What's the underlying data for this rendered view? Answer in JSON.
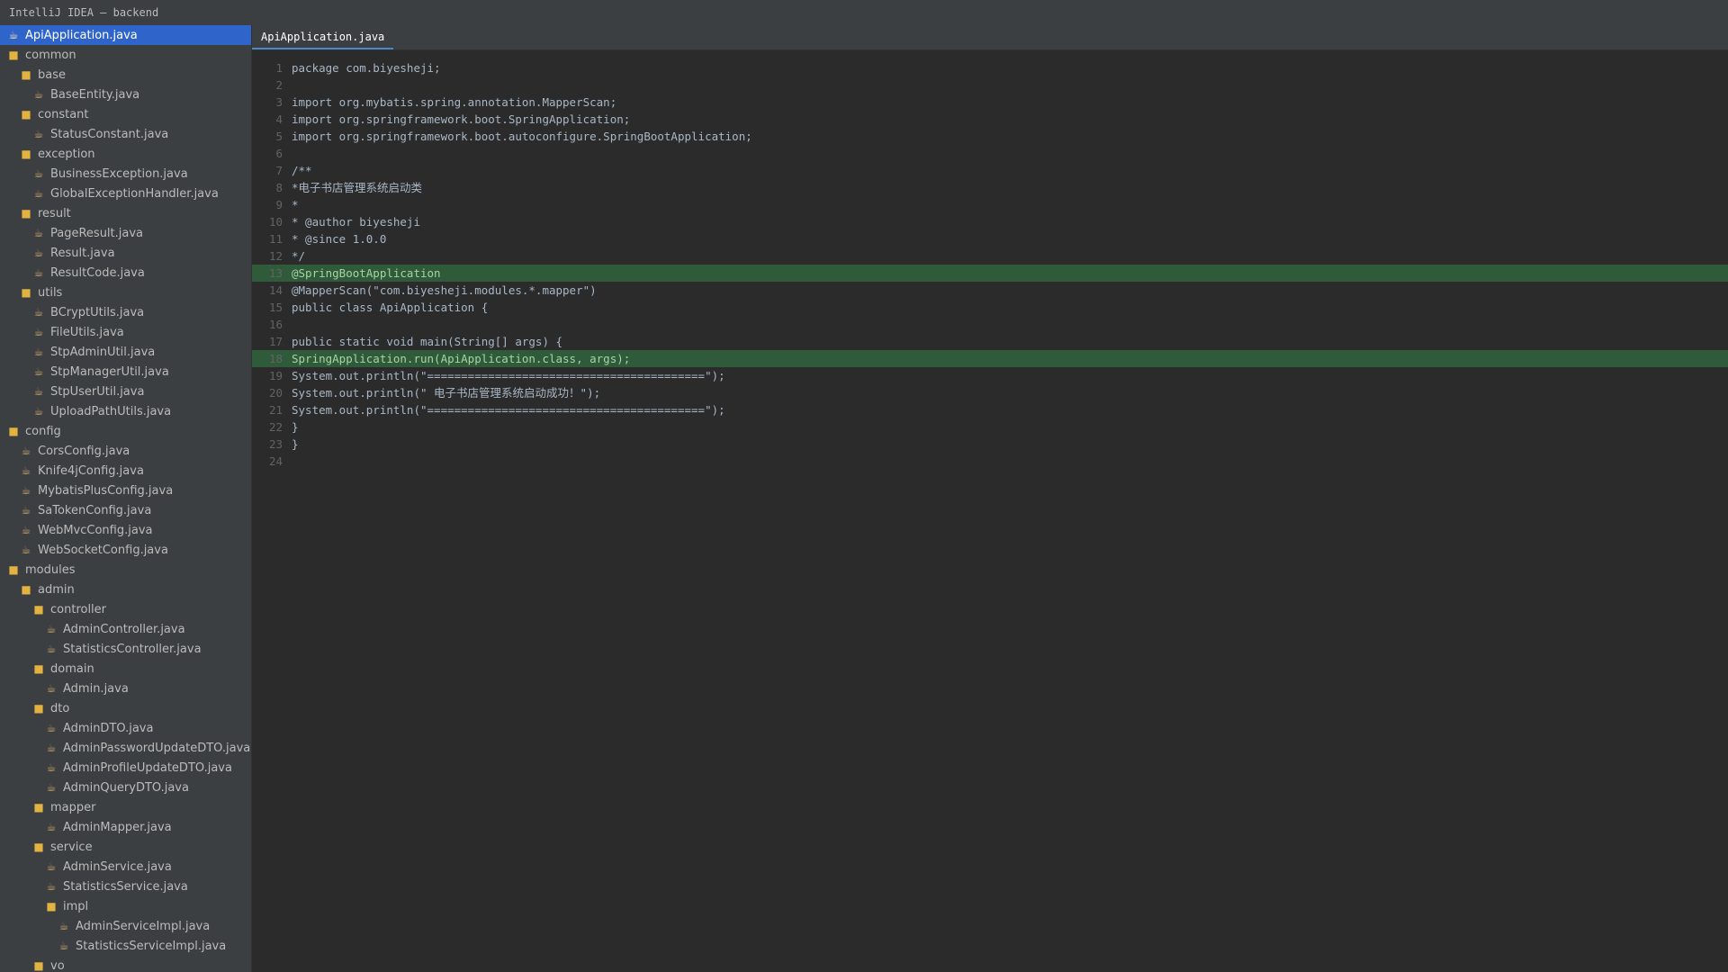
{
  "window": {
    "title": "IntelliJ IDEA — backend"
  },
  "editor": {
    "tab_label": "ApiApplication.java"
  },
  "icons": {
    "folder": "folder-icon",
    "file": "java-file-icon"
  },
  "colors": {
    "selection": "#2f65ca",
    "highlight": "#2f5b3a",
    "accent": "#4a88c7"
  },
  "tree": [
    {
      "label": "ApiApplication.java",
      "type": "file",
      "depth": 0,
      "selected": true
    },
    {
      "label": "common",
      "type": "folder",
      "depth": 0
    },
    {
      "label": "base",
      "type": "folder",
      "depth": 1
    },
    {
      "label": "BaseEntity.java",
      "type": "file",
      "depth": 2
    },
    {
      "label": "constant",
      "type": "folder",
      "depth": 1
    },
    {
      "label": "StatusConstant.java",
      "type": "file",
      "depth": 2
    },
    {
      "label": "exception",
      "type": "folder",
      "depth": 1
    },
    {
      "label": "BusinessException.java",
      "type": "file",
      "depth": 2
    },
    {
      "label": "GlobalExceptionHandler.java",
      "type": "file",
      "depth": 2
    },
    {
      "label": "result",
      "type": "folder",
      "depth": 1
    },
    {
      "label": "PageResult.java",
      "type": "file",
      "depth": 2
    },
    {
      "label": "Result.java",
      "type": "file",
      "depth": 2
    },
    {
      "label": "ResultCode.java",
      "type": "file",
      "depth": 2
    },
    {
      "label": "utils",
      "type": "folder",
      "depth": 1
    },
    {
      "label": "BCryptUtils.java",
      "type": "file",
      "depth": 2
    },
    {
      "label": "FileUtils.java",
      "type": "file",
      "depth": 2
    },
    {
      "label": "StpAdminUtil.java",
      "type": "file",
      "depth": 2
    },
    {
      "label": "StpManagerUtil.java",
      "type": "file",
      "depth": 2
    },
    {
      "label": "StpUserUtil.java",
      "type": "file",
      "depth": 2
    },
    {
      "label": "UploadPathUtils.java",
      "type": "file",
      "depth": 2
    },
    {
      "label": "config",
      "type": "folder",
      "depth": 0
    },
    {
      "label": "CorsConfig.java",
      "type": "file",
      "depth": 1
    },
    {
      "label": "Knife4jConfig.java",
      "type": "file",
      "depth": 1
    },
    {
      "label": "MybatisPlusConfig.java",
      "type": "file",
      "depth": 1
    },
    {
      "label": "SaTokenConfig.java",
      "type": "file",
      "depth": 1
    },
    {
      "label": "WebMvcConfig.java",
      "type": "file",
      "depth": 1
    },
    {
      "label": "WebSocketConfig.java",
      "type": "file",
      "depth": 1
    },
    {
      "label": "modules",
      "type": "folder",
      "depth": 0
    },
    {
      "label": "admin",
      "type": "folder",
      "depth": 1
    },
    {
      "label": "controller",
      "type": "folder",
      "depth": 2
    },
    {
      "label": "AdminController.java",
      "type": "file",
      "depth": 3
    },
    {
      "label": "StatisticsController.java",
      "type": "file",
      "depth": 3
    },
    {
      "label": "domain",
      "type": "folder",
      "depth": 2
    },
    {
      "label": "Admin.java",
      "type": "file",
      "depth": 3
    },
    {
      "label": "dto",
      "type": "folder",
      "depth": 2
    },
    {
      "label": "AdminDTO.java",
      "type": "file",
      "depth": 3
    },
    {
      "label": "AdminPasswordUpdateDTO.java",
      "type": "file",
      "depth": 3
    },
    {
      "label": "AdminProfileUpdateDTO.java",
      "type": "file",
      "depth": 3
    },
    {
      "label": "AdminQueryDTO.java",
      "type": "file",
      "depth": 3
    },
    {
      "label": "mapper",
      "type": "folder",
      "depth": 2
    },
    {
      "label": "AdminMapper.java",
      "type": "file",
      "depth": 3
    },
    {
      "label": "service",
      "type": "folder",
      "depth": 2
    },
    {
      "label": "AdminService.java",
      "type": "file",
      "depth": 3
    },
    {
      "label": "StatisticsService.java",
      "type": "file",
      "depth": 3
    },
    {
      "label": "impl",
      "type": "folder",
      "depth": 3
    },
    {
      "label": "AdminServiceImpl.java",
      "type": "file",
      "depth": 4
    },
    {
      "label": "StatisticsServiceImpl.java",
      "type": "file",
      "depth": 4
    },
    {
      "label": "vo",
      "type": "folder",
      "depth": 2
    }
  ],
  "code": [
    {
      "n": "1",
      "text": "package com.biyesheji;"
    },
    {
      "n": "2",
      "text": ""
    },
    {
      "n": "3",
      "text": "import org.mybatis.spring.annotation.MapperScan;"
    },
    {
      "n": "4",
      "text": "import org.springframework.boot.SpringApplication;"
    },
    {
      "n": "5",
      "text": "import org.springframework.boot.autoconfigure.SpringBootApplication;"
    },
    {
      "n": "6",
      "text": ""
    },
    {
      "n": "7",
      "text": "/**"
    },
    {
      "n": "8",
      "text": "*电子书店管理系统启动类"
    },
    {
      "n": "9",
      "text": "*"
    },
    {
      "n": "10",
      "text": "* @author biyesheji"
    },
    {
      "n": "11",
      "text": "* @since 1.0.0"
    },
    {
      "n": "12",
      "text": "*/"
    },
    {
      "n": "13",
      "text": "@SpringBootApplication",
      "hl": true
    },
    {
      "n": "14",
      "text": "@MapperScan(\"com.biyesheji.modules.*.mapper\")"
    },
    {
      "n": "15",
      "text": "public class ApiApplication {"
    },
    {
      "n": "16",
      "text": ""
    },
    {
      "n": "17",
      "text": "public static void main(String[] args) {"
    },
    {
      "n": "18",
      "text": "SpringApplication.run(ApiApplication.class, args);",
      "hl": true
    },
    {
      "n": "19",
      "text": "System.out.println(\"=========================================\");"
    },
    {
      "n": "20",
      "text": "System.out.println(\" 电子书店管理系统启动成功！\");"
    },
    {
      "n": "21",
      "text": "System.out.println(\"=========================================\");"
    },
    {
      "n": "22",
      "text": "}"
    },
    {
      "n": "23",
      "text": "}"
    },
    {
      "n": "24",
      "text": ""
    }
  ]
}
